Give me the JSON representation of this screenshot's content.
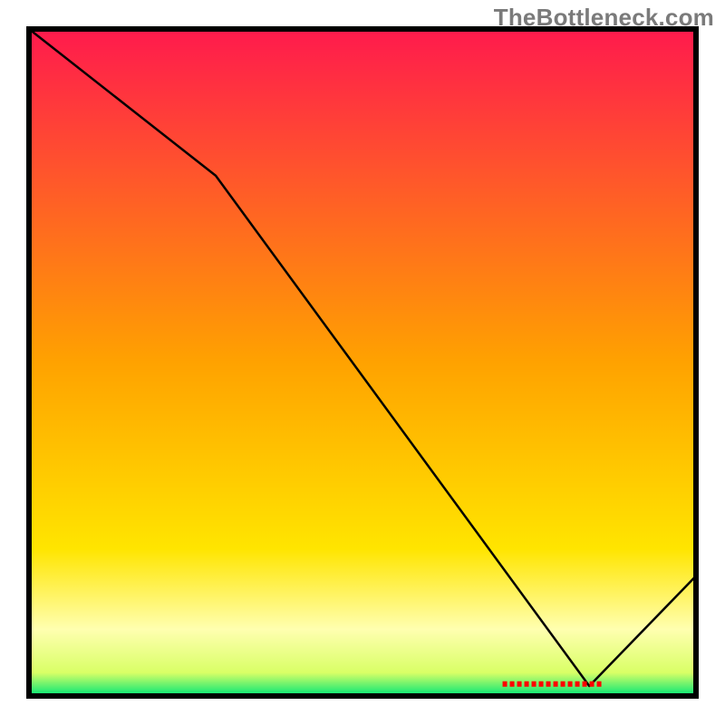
{
  "watermark": "TheBottleneck.com",
  "chart_data": {
    "type": "line",
    "title": "",
    "xlabel": "",
    "ylabel": "",
    "xlim": [
      0,
      100
    ],
    "ylim": [
      0,
      100
    ],
    "series": [
      {
        "name": "curve",
        "x": [
          0,
          28,
          84,
          100
        ],
        "y": [
          100,
          78,
          1.5,
          18
        ]
      }
    ],
    "marker": {
      "name": "horizontal-dash-band",
      "x_start": 71,
      "x_end": 86,
      "y": 1.8,
      "color": "#ff0000"
    },
    "gradient": {
      "direction": "vertical",
      "stops": [
        {
          "offset": 0.0,
          "color": "#ff1a4d"
        },
        {
          "offset": 0.5,
          "color": "#ffa200"
        },
        {
          "offset": 0.78,
          "color": "#ffe500"
        },
        {
          "offset": 0.9,
          "color": "#ffffb0"
        },
        {
          "offset": 0.965,
          "color": "#d9ff66"
        },
        {
          "offset": 1.0,
          "color": "#00e676"
        }
      ]
    },
    "border_color": "#000000"
  }
}
